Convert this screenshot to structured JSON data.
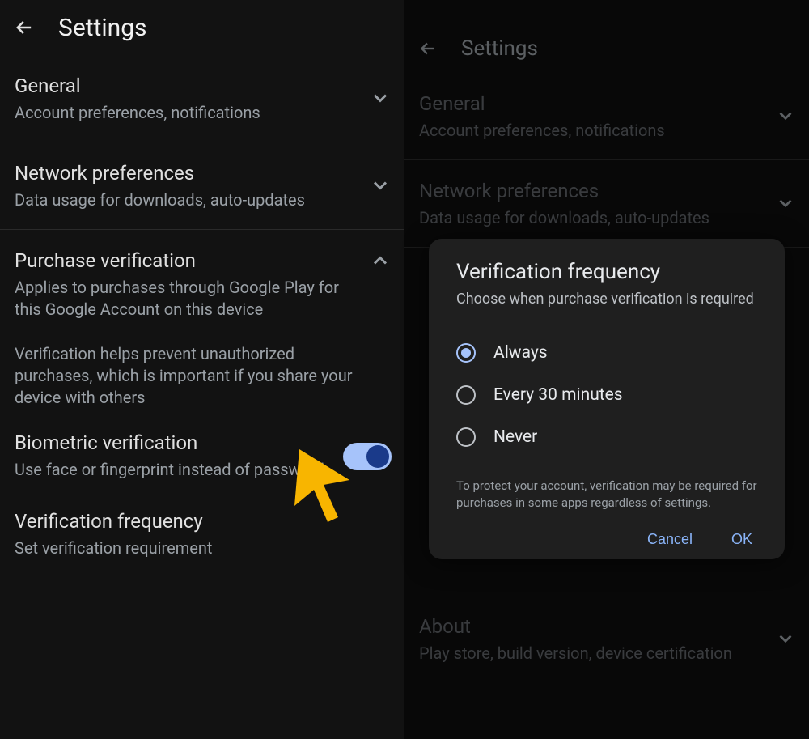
{
  "left": {
    "title": "Settings",
    "general": {
      "title": "General",
      "sub": "Account preferences, notifications"
    },
    "network": {
      "title": "Network preferences",
      "sub": "Data usage for downloads, auto-updates"
    },
    "purchase": {
      "title": "Purchase verification",
      "sub": "Applies to purchases through Google Play for this Google Account on this device",
      "desc": "Verification helps prevent unauthorized purchases, which is important if you share your device with others"
    },
    "biometric": {
      "title": "Biometric verification",
      "sub": "Use face or fingerprint instead of password",
      "enabled": true
    },
    "freq": {
      "title": "Verification frequency",
      "sub": "Set verification requirement"
    }
  },
  "right": {
    "title": "Settings",
    "general": {
      "title": "General",
      "sub": "Account preferences, notifications"
    },
    "network": {
      "title": "Network preferences",
      "sub": "Data usage for downloads, auto-updates"
    },
    "about": {
      "title": "About",
      "sub": "Play store, build version, device certification"
    },
    "dialog": {
      "title": "Verification frequency",
      "sub": "Choose when purchase verification is required",
      "options": [
        {
          "label": "Always",
          "selected": true
        },
        {
          "label": "Every 30 minutes",
          "selected": false
        },
        {
          "label": "Never",
          "selected": false
        }
      ],
      "note": "To protect your account, verification may be required for purchases in some apps regardless of settings.",
      "cancel": "Cancel",
      "ok": "OK"
    }
  }
}
